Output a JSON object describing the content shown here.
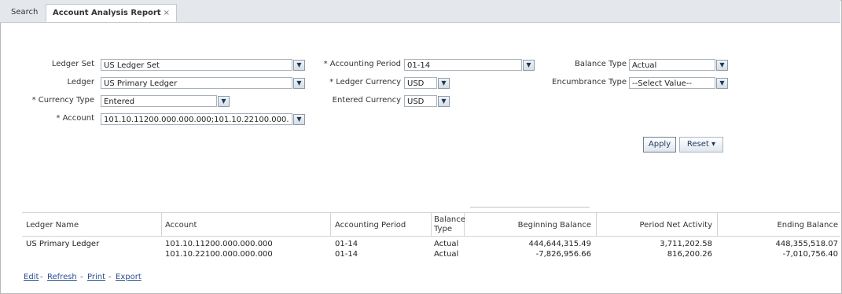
{
  "tabs": [
    {
      "label": "Search"
    },
    {
      "label": "Account Analysis Report",
      "close": "×"
    }
  ],
  "form": {
    "ledger_set": {
      "label": "Ledger Set",
      "value": "US Ledger Set"
    },
    "ledger": {
      "label": "Ledger",
      "value": "US Primary Ledger"
    },
    "currency_type": {
      "label": "* Currency Type",
      "value": "Entered"
    },
    "account": {
      "label": "* Account",
      "value": "101.10.11200.000.000.000;101.10.22100.000."
    },
    "accounting_period": {
      "label": "* Accounting Period",
      "value": "01-14"
    },
    "ledger_currency": {
      "label": "* Ledger Currency",
      "value": "USD"
    },
    "entered_currency": {
      "label": "Entered Currency",
      "value": "USD"
    },
    "balance_type": {
      "label": "Balance Type",
      "value": "Actual"
    },
    "encumbrance_type": {
      "label": "Encumbrance Type",
      "value": "--Select Value--"
    }
  },
  "buttons": {
    "apply": "Apply",
    "reset": "Reset ▾"
  },
  "table": {
    "headers": {
      "ledger_name": "Ledger Name",
      "account": "Account",
      "accounting_period": "Accounting Period",
      "balance_type_1": "Balance",
      "balance_type_2": "Type",
      "beginning_balance": "Beginning Balance",
      "period_net_activity": "Period Net Activity",
      "ending_balance": "Ending Balance"
    },
    "rows": [
      {
        "ledger_name": "US Primary Ledger",
        "account": "101.10.11200.000.000.000",
        "period": "01-14",
        "balance_type": "Actual",
        "beginning": "444,644,315.49",
        "net": "3,711,202.58",
        "ending": "448,355,518.07"
      },
      {
        "ledger_name": "",
        "account": "101.10.22100.000.000.000",
        "period": "01-14",
        "balance_type": "Actual",
        "beginning": "-7,826,956.66",
        "net": "816,200.26",
        "ending": "-7,010,756.40"
      }
    ]
  },
  "actions": {
    "edit": "Edit",
    "refresh": "Refresh",
    "print": "Print",
    "export": "Export",
    "separator": "-"
  },
  "colors": {
    "link": "#2a4f90",
    "tabbar": "#e4e8ec",
    "border": "#a9b2bb"
  },
  "icons": {
    "dropdown": "chevron-down-icon"
  }
}
